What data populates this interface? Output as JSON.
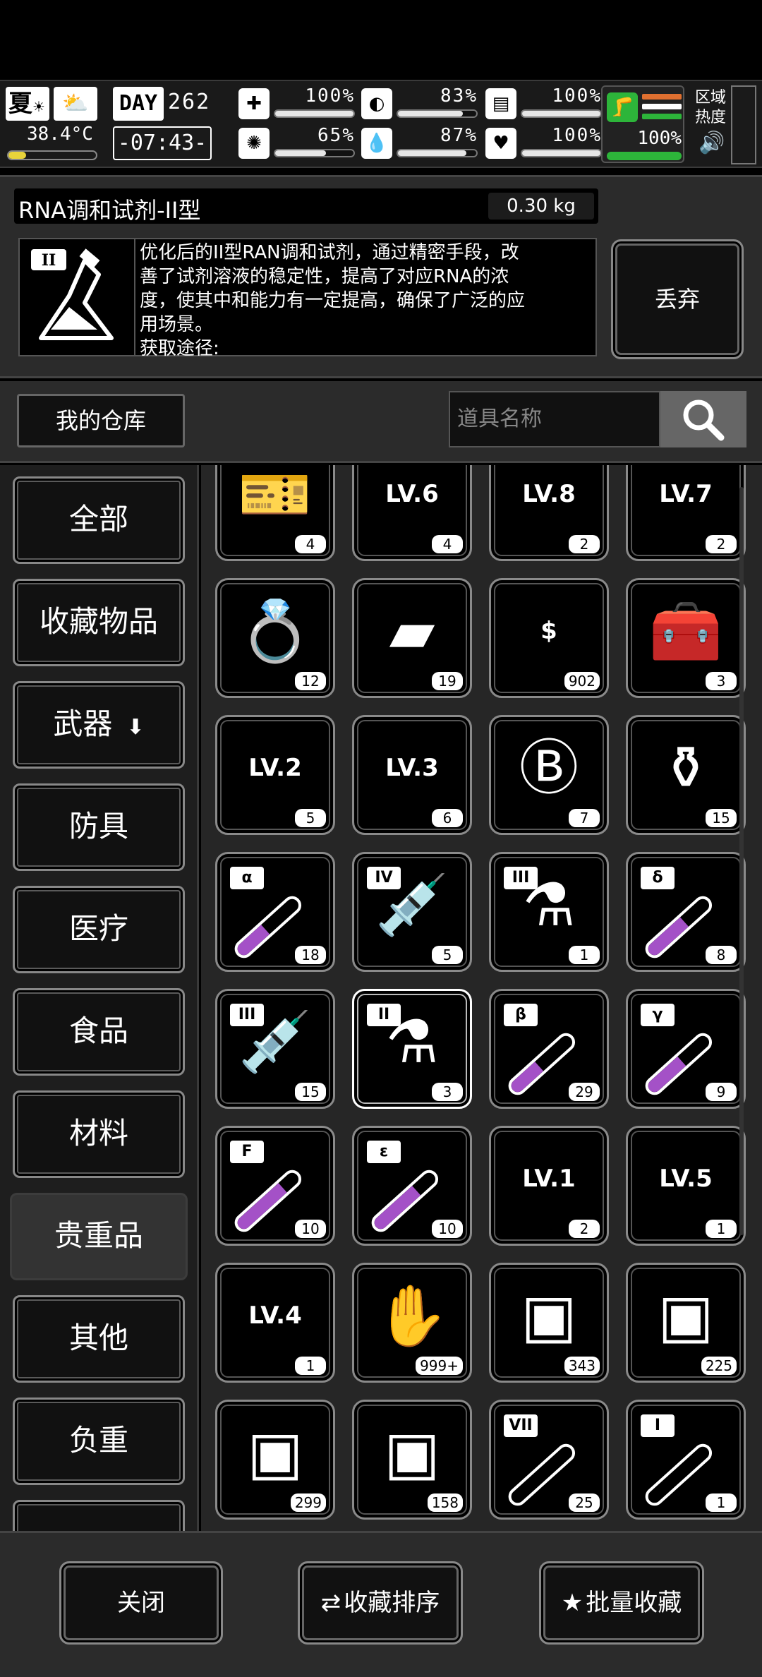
{
  "hud": {
    "season": "夏",
    "weather_icon": "cloud-sun-icon",
    "temperature": "38.4°C",
    "temperature_level": 0.2,
    "day_label": "DAY",
    "day_number": "262",
    "clock": "-07:43-",
    "stats": [
      {
        "icon": "medkit-icon",
        "glyph": "✚",
        "value": "100%",
        "level": 1.0
      },
      {
        "icon": "stomach-icon",
        "glyph": "◐",
        "value": "83%",
        "level": 0.83
      },
      {
        "icon": "armor-icon",
        "glyph": "▤",
        "value": "100%",
        "level": 1.0
      },
      {
        "icon": "brain-icon",
        "glyph": "✺",
        "value": "65%",
        "level": 0.65
      },
      {
        "icon": "water-drop-icon",
        "glyph": "💧",
        "value": "87%",
        "level": 0.87
      },
      {
        "icon": "heart-icon",
        "glyph": "♥",
        "value": "100%",
        "level": 1.0
      }
    ],
    "stamina": "100%",
    "stamina_lines": [
      "#e07030",
      "#ffffff",
      "#2db53a"
    ],
    "zone_label_1": "区域",
    "zone_label_2": "热度",
    "speaker_icon": "speaker-icon"
  },
  "detail": {
    "item_name": "RNA调和试剂-II型",
    "weight": "0.30 kg",
    "tier_tag": "II",
    "description_lines": [
      "优化后的II型RAN调和试剂，通过精密手段，改",
      "善了试剂溶液的稳定性，提高了对应RNA的浓",
      "度，使其中和能力有一定提高，确保了广泛的应",
      "用场景。",
      "获取途径:"
    ],
    "discard_label": "丢弃"
  },
  "warehouse": {
    "title": "我的仓库",
    "search_placeholder": "道具名称",
    "search_icon": "magnifier-icon"
  },
  "categories": [
    {
      "label": "全部",
      "active": false
    },
    {
      "label": "收藏物品",
      "active": false
    },
    {
      "label": "武器",
      "active": false,
      "arrow": "⬇"
    },
    {
      "label": "防具",
      "active": false
    },
    {
      "label": "医疗",
      "active": false
    },
    {
      "label": "食品",
      "active": false
    },
    {
      "label": "材料",
      "active": false
    },
    {
      "label": "贵重品",
      "active": true
    },
    {
      "label": "其他",
      "active": false
    },
    {
      "label": "负重",
      "active": false
    },
    {
      "label": "···",
      "active": false
    }
  ],
  "items": [
    {
      "icon": "ticket-icon",
      "glyph": "🎫",
      "count": "4"
    },
    {
      "icon": "skill-book-lv6-icon",
      "glyph": "LV.6",
      "count": "4"
    },
    {
      "icon": "skill-book-lv8-icon",
      "glyph": "LV.8",
      "count": "2"
    },
    {
      "icon": "skill-book-lv7-icon",
      "glyph": "LV.7",
      "count": "2"
    },
    {
      "icon": "ring-icon",
      "glyph": "💍",
      "count": "12"
    },
    {
      "icon": "gold-bars-icon",
      "glyph": "▰",
      "count": "19"
    },
    {
      "icon": "cash-stack-icon",
      "glyph": "$",
      "count": "902"
    },
    {
      "icon": "toolbox-icon",
      "glyph": "🧰",
      "count": "3"
    },
    {
      "icon": "skill-book-lv2-icon",
      "glyph": "LV.2",
      "count": "5"
    },
    {
      "icon": "skill-book-lv3-icon",
      "glyph": "LV.3",
      "count": "6"
    },
    {
      "icon": "casino-chip-icon",
      "glyph": "Ⓑ",
      "count": "7"
    },
    {
      "icon": "vase-icon",
      "glyph": "⚱",
      "count": "15"
    },
    {
      "icon": "test-tube-alpha-icon",
      "glyph": "vial",
      "tag": "α",
      "fill": 0.45,
      "count": "18"
    },
    {
      "icon": "syringe-iv-icon",
      "glyph": "💉",
      "tag": "IV",
      "count": "5"
    },
    {
      "icon": "flask-iii-icon",
      "glyph": "⚗",
      "tag": "III",
      "count": "1"
    },
    {
      "icon": "test-tube-delta-icon",
      "glyph": "vial",
      "tag": "δ",
      "fill": 0.6,
      "count": "8"
    },
    {
      "icon": "syringe-iii-icon",
      "glyph": "💉",
      "tag": "III",
      "count": "15"
    },
    {
      "icon": "flask-ii-icon",
      "glyph": "⚗",
      "tag": "II",
      "count": "3",
      "selected": true
    },
    {
      "icon": "test-tube-beta-icon",
      "glyph": "vial",
      "tag": "β",
      "fill": 0.45,
      "count": "29"
    },
    {
      "icon": "test-tube-gamma-icon",
      "glyph": "vial",
      "tag": "γ",
      "fill": 0.55,
      "count": "9"
    },
    {
      "icon": "test-tube-f-icon",
      "glyph": "vial",
      "tag": "F",
      "fill": 0.75,
      "count": "10"
    },
    {
      "icon": "test-tube-epsilon-icon",
      "glyph": "vial",
      "tag": "ε",
      "fill": 0.7,
      "count": "10"
    },
    {
      "icon": "skill-book-lv1-icon",
      "glyph": "LV.1",
      "count": "2"
    },
    {
      "icon": "skill-book-lv5-icon",
      "glyph": "LV.5",
      "count": "1"
    },
    {
      "icon": "skill-book-lv4-icon",
      "glyph": "LV.4",
      "count": "1"
    },
    {
      "icon": "zombie-card-icon",
      "glyph": "✋",
      "count": "999+"
    },
    {
      "icon": "chest-i-icon",
      "glyph": "▣",
      "count": "343"
    },
    {
      "icon": "chest-ii-icon",
      "glyph": "▣",
      "count": "225"
    },
    {
      "icon": "chest-iii-icon",
      "glyph": "▣",
      "count": "299"
    },
    {
      "icon": "chest-iv-icon",
      "glyph": "▣",
      "count": "158"
    },
    {
      "icon": "test-tube-vii-icon",
      "glyph": "vial",
      "tag": "VII",
      "fill": 0.0,
      "count": "25"
    },
    {
      "icon": "test-tube-i-icon",
      "glyph": "vial",
      "tag": "I",
      "fill": 0.0,
      "count": "1"
    }
  ],
  "footer": {
    "close_label": "关闭",
    "sort_label": "收藏排序",
    "sort_icon": "swap-arrows-icon",
    "batch_label": "批量收藏",
    "batch_icon": "star-icon"
  },
  "colors": {
    "accent_green": "#2db53a",
    "liquid_purple": "#a451c7",
    "panel": "#2b2b2b"
  }
}
